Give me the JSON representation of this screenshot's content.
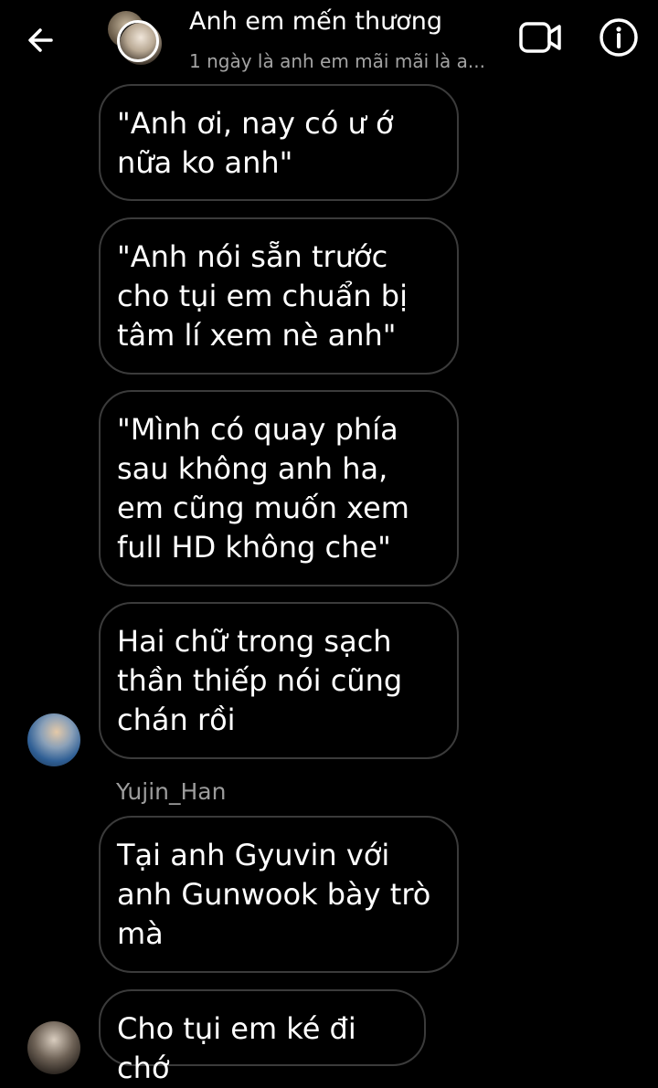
{
  "header": {
    "title": "Anh em mến thương",
    "subtitle": "1 ngày là anh em mãi mãi là a..."
  },
  "messages": [
    {
      "text": "\"Anh ơi, nay có ư ớ nữa ko anh\""
    },
    {
      "text": "\"Anh nói sẵn trước cho tụi em chuẩn bị tâm lí xem nè anh\""
    },
    {
      "text": "\"Mình có quay phía sau không anh ha, em cũng muốn xem full HD không che\""
    },
    {
      "text": "Hai chữ trong sạch thần thiếp nói cũng chán rồi"
    },
    {
      "sender": "Yujin_Han",
      "text": "Tại anh Gyuvin với anh Gunwook bày trò mà"
    },
    {
      "text": "Cho tụi em ké đi chớ"
    }
  ],
  "icons": {
    "back": "back-arrow-icon",
    "video": "video-camera-icon",
    "info": "info-icon"
  }
}
